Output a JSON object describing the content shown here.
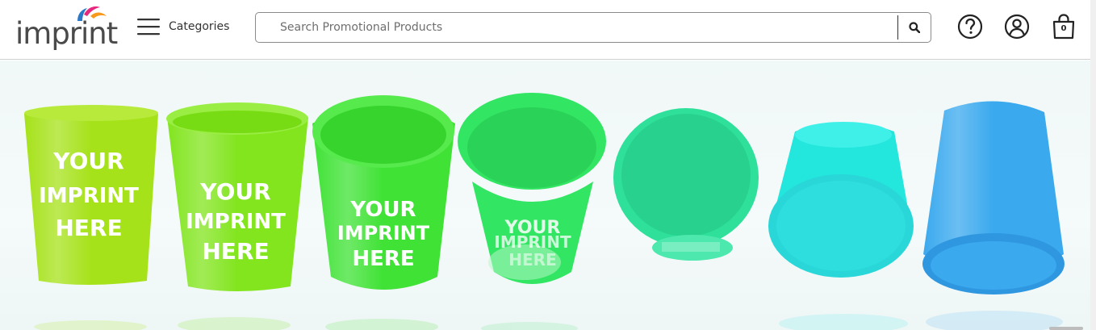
{
  "brand": {
    "logo_text": "imprint"
  },
  "header": {
    "categories_label": "Categories",
    "search": {
      "placeholder": "Search Promotional Products",
      "value": ""
    },
    "cart_count": "0"
  },
  "hero": {
    "cups": [
      {
        "lines": [
          "YOUR",
          "IMPRINT",
          "HERE"
        ],
        "color": "#a6e21a"
      },
      {
        "lines": [
          "YOUR",
          "IMPRINT",
          "HERE"
        ],
        "color": "#82e51e"
      },
      {
        "lines": [
          "YOUR",
          "IMPRINT",
          "HERE"
        ],
        "color": "#3fe235"
      },
      {
        "lines": [
          "YOUR",
          "IMPRINT",
          "HERE"
        ],
        "color": "#32e563"
      },
      {
        "lines": [],
        "color": "#2ee09a"
      },
      {
        "lines": [],
        "color": "#23e6dc"
      },
      {
        "lines": [],
        "color": "#3aa9ee"
      }
    ]
  },
  "colors": {
    "text": "#333333",
    "border": "#cfcfcf",
    "logo_orange": "#f79a1d",
    "logo_pink": "#e6287e",
    "logo_blue": "#2b79c9"
  }
}
